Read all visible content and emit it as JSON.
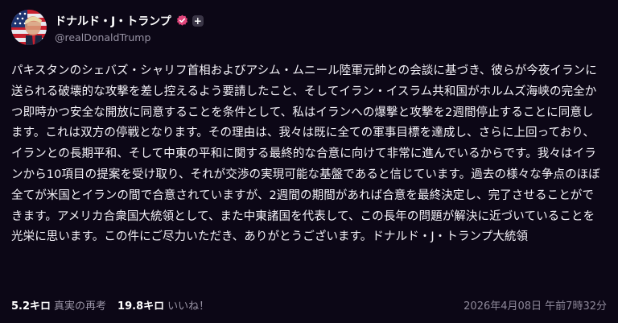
{
  "author": {
    "display_name": "ドナルド・J・トランプ",
    "handle": "@realDonaldTrump",
    "avatar_icon": "flag-avatar",
    "verified_icon": "verified-badge-icon",
    "verified_color": "#e0457b",
    "plus_label": "+"
  },
  "post": {
    "text": "パキスタンのシェバズ・シャリフ首相およびアシム・ムニール陸軍元帥との会談に基づき、彼らが今夜イランに送られる破壊的な攻撃を差し控えるよう要請したこと、そしてイラン・イスラム共和国がホルムズ海峡の完全かつ即時かつ安全な開放に同意することを条件として、私はイランへの爆撃と攻撃を2週間停止することに同意します。これは双方の停戦となります。その理由は、我々は既に全ての軍事目標を達成し、さらに上回っており、イランとの長期平和、そして中東の平和に関する最終的な合意に向けて非常に進んでいるからです。我々はイランから10項目の提案を受け取り、それが交渉の実現可能な基盤であると信じています。過去の様々な争点のほぼ全てが米国とイランの間で合意されていますが、2週間の期間があれば合意を最終決定し、完了させることができます。アメリカ合衆国大統領として、また中東諸国を代表して、この長年の問題が解決に近づいていることを光栄に思います。この件にご尽力いただき、ありがとうございます。ドナルド・J・トランプ大統領"
  },
  "stats": {
    "reposts_count": "5.2キロ",
    "reposts_label": "真実の再考",
    "likes_count": "19.8キロ",
    "likes_label": "いいね！"
  },
  "timestamp": "2026年4月08日 午前7時32分"
}
